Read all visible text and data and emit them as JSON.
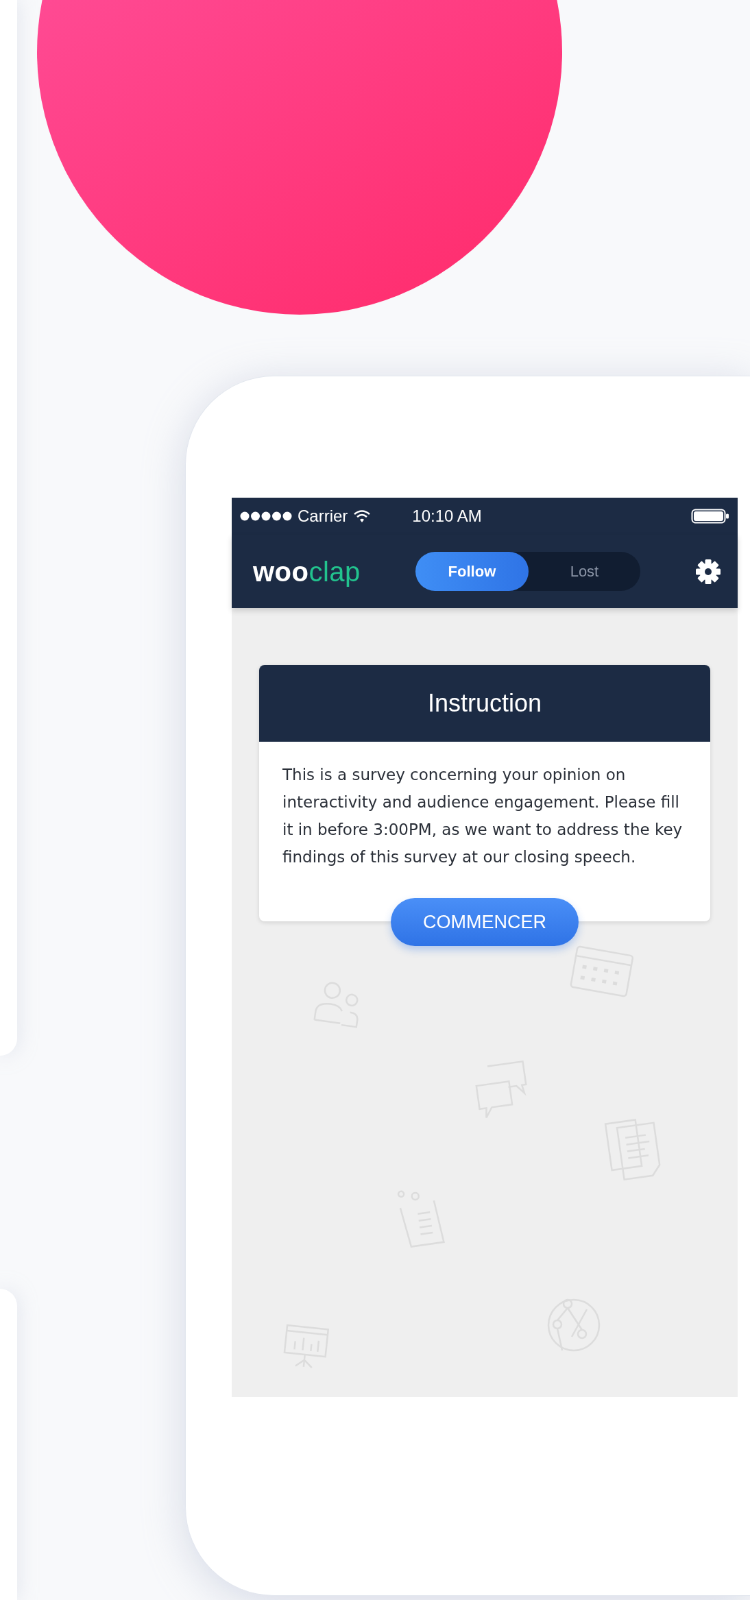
{
  "status_bar": {
    "carrier": "Carrier",
    "time": "10:10 AM"
  },
  "header": {
    "logo": {
      "bold": "woo",
      "light": "clap"
    },
    "tabs": [
      {
        "label": "Follow",
        "selected": true
      },
      {
        "label": "Lost",
        "selected": false
      }
    ]
  },
  "card": {
    "title": "Instruction",
    "body": "This is a survey concerning your opinion on interactivity and audience engagement. Please fill it in before 3:00PM, as we want to address the key findings of this survey at our closing speech.",
    "button": "COMMENCER"
  }
}
